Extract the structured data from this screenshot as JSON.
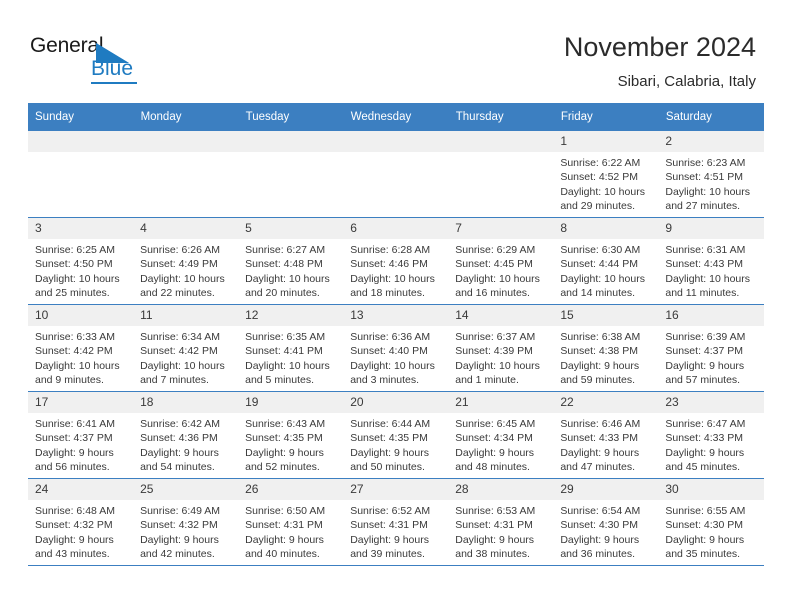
{
  "brand": {
    "name_part1": "General",
    "name_part2": "Blue",
    "accent_color": "#1f7bc1",
    "logo_icon": "triangle-mark"
  },
  "header": {
    "title": "November 2024",
    "subtitle": "Sibari, Calabria, Italy"
  },
  "calendar": {
    "header_bg": "#3c7fc1",
    "daynum_bg": "#f0f0f0",
    "weekday_headers": [
      "Sunday",
      "Monday",
      "Tuesday",
      "Wednesday",
      "Thursday",
      "Friday",
      "Saturday"
    ],
    "labels": {
      "sunrise": "Sunrise:",
      "sunset": "Sunset:",
      "daylight": "Daylight:"
    },
    "weeks": [
      [
        {
          "day": ""
        },
        {
          "day": ""
        },
        {
          "day": ""
        },
        {
          "day": ""
        },
        {
          "day": ""
        },
        {
          "day": "1",
          "sunrise": "Sunrise: 6:22 AM",
          "sunset": "Sunset: 4:52 PM",
          "daylight": "Daylight: 10 hours and 29 minutes."
        },
        {
          "day": "2",
          "sunrise": "Sunrise: 6:23 AM",
          "sunset": "Sunset: 4:51 PM",
          "daylight": "Daylight: 10 hours and 27 minutes."
        }
      ],
      [
        {
          "day": "3",
          "sunrise": "Sunrise: 6:25 AM",
          "sunset": "Sunset: 4:50 PM",
          "daylight": "Daylight: 10 hours and 25 minutes."
        },
        {
          "day": "4",
          "sunrise": "Sunrise: 6:26 AM",
          "sunset": "Sunset: 4:49 PM",
          "daylight": "Daylight: 10 hours and 22 minutes."
        },
        {
          "day": "5",
          "sunrise": "Sunrise: 6:27 AM",
          "sunset": "Sunset: 4:48 PM",
          "daylight": "Daylight: 10 hours and 20 minutes."
        },
        {
          "day": "6",
          "sunrise": "Sunrise: 6:28 AM",
          "sunset": "Sunset: 4:46 PM",
          "daylight": "Daylight: 10 hours and 18 minutes."
        },
        {
          "day": "7",
          "sunrise": "Sunrise: 6:29 AM",
          "sunset": "Sunset: 4:45 PM",
          "daylight": "Daylight: 10 hours and 16 minutes."
        },
        {
          "day": "8",
          "sunrise": "Sunrise: 6:30 AM",
          "sunset": "Sunset: 4:44 PM",
          "daylight": "Daylight: 10 hours and 14 minutes."
        },
        {
          "day": "9",
          "sunrise": "Sunrise: 6:31 AM",
          "sunset": "Sunset: 4:43 PM",
          "daylight": "Daylight: 10 hours and 11 minutes."
        }
      ],
      [
        {
          "day": "10",
          "sunrise": "Sunrise: 6:33 AM",
          "sunset": "Sunset: 4:42 PM",
          "daylight": "Daylight: 10 hours and 9 minutes."
        },
        {
          "day": "11",
          "sunrise": "Sunrise: 6:34 AM",
          "sunset": "Sunset: 4:42 PM",
          "daylight": "Daylight: 10 hours and 7 minutes."
        },
        {
          "day": "12",
          "sunrise": "Sunrise: 6:35 AM",
          "sunset": "Sunset: 4:41 PM",
          "daylight": "Daylight: 10 hours and 5 minutes."
        },
        {
          "day": "13",
          "sunrise": "Sunrise: 6:36 AM",
          "sunset": "Sunset: 4:40 PM",
          "daylight": "Daylight: 10 hours and 3 minutes."
        },
        {
          "day": "14",
          "sunrise": "Sunrise: 6:37 AM",
          "sunset": "Sunset: 4:39 PM",
          "daylight": "Daylight: 10 hours and 1 minute."
        },
        {
          "day": "15",
          "sunrise": "Sunrise: 6:38 AM",
          "sunset": "Sunset: 4:38 PM",
          "daylight": "Daylight: 9 hours and 59 minutes."
        },
        {
          "day": "16",
          "sunrise": "Sunrise: 6:39 AM",
          "sunset": "Sunset: 4:37 PM",
          "daylight": "Daylight: 9 hours and 57 minutes."
        }
      ],
      [
        {
          "day": "17",
          "sunrise": "Sunrise: 6:41 AM",
          "sunset": "Sunset: 4:37 PM",
          "daylight": "Daylight: 9 hours and 56 minutes."
        },
        {
          "day": "18",
          "sunrise": "Sunrise: 6:42 AM",
          "sunset": "Sunset: 4:36 PM",
          "daylight": "Daylight: 9 hours and 54 minutes."
        },
        {
          "day": "19",
          "sunrise": "Sunrise: 6:43 AM",
          "sunset": "Sunset: 4:35 PM",
          "daylight": "Daylight: 9 hours and 52 minutes."
        },
        {
          "day": "20",
          "sunrise": "Sunrise: 6:44 AM",
          "sunset": "Sunset: 4:35 PM",
          "daylight": "Daylight: 9 hours and 50 minutes."
        },
        {
          "day": "21",
          "sunrise": "Sunrise: 6:45 AM",
          "sunset": "Sunset: 4:34 PM",
          "daylight": "Daylight: 9 hours and 48 minutes."
        },
        {
          "day": "22",
          "sunrise": "Sunrise: 6:46 AM",
          "sunset": "Sunset: 4:33 PM",
          "daylight": "Daylight: 9 hours and 47 minutes."
        },
        {
          "day": "23",
          "sunrise": "Sunrise: 6:47 AM",
          "sunset": "Sunset: 4:33 PM",
          "daylight": "Daylight: 9 hours and 45 minutes."
        }
      ],
      [
        {
          "day": "24",
          "sunrise": "Sunrise: 6:48 AM",
          "sunset": "Sunset: 4:32 PM",
          "daylight": "Daylight: 9 hours and 43 minutes."
        },
        {
          "day": "25",
          "sunrise": "Sunrise: 6:49 AM",
          "sunset": "Sunset: 4:32 PM",
          "daylight": "Daylight: 9 hours and 42 minutes."
        },
        {
          "day": "26",
          "sunrise": "Sunrise: 6:50 AM",
          "sunset": "Sunset: 4:31 PM",
          "daylight": "Daylight: 9 hours and 40 minutes."
        },
        {
          "day": "27",
          "sunrise": "Sunrise: 6:52 AM",
          "sunset": "Sunset: 4:31 PM",
          "daylight": "Daylight: 9 hours and 39 minutes."
        },
        {
          "day": "28",
          "sunrise": "Sunrise: 6:53 AM",
          "sunset": "Sunset: 4:31 PM",
          "daylight": "Daylight: 9 hours and 38 minutes."
        },
        {
          "day": "29",
          "sunrise": "Sunrise: 6:54 AM",
          "sunset": "Sunset: 4:30 PM",
          "daylight": "Daylight: 9 hours and 36 minutes."
        },
        {
          "day": "30",
          "sunrise": "Sunrise: 6:55 AM",
          "sunset": "Sunset: 4:30 PM",
          "daylight": "Daylight: 9 hours and 35 minutes."
        }
      ]
    ]
  }
}
